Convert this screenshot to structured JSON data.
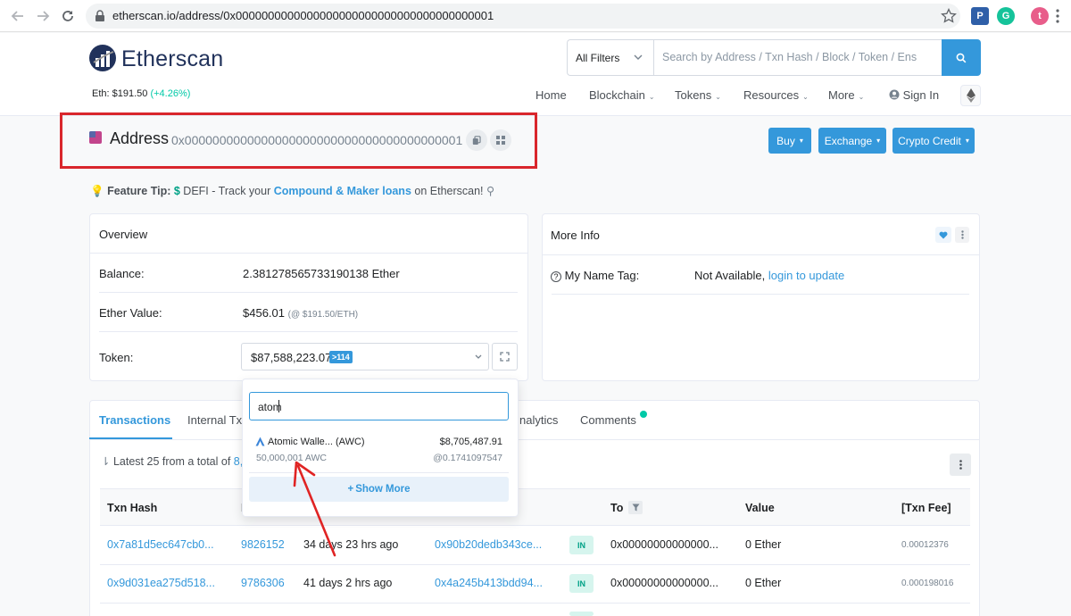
{
  "browser": {
    "url": "etherscan.io/address/0x0000000000000000000000000000000000000001",
    "profile_initial": "t"
  },
  "header": {
    "logo_text": "Etherscan",
    "eth_price_label": "Eth: $191.50",
    "eth_price_change": "(+4.26%)",
    "filter_label": "All Filters",
    "search_placeholder": "Search by Address / Txn Hash / Block / Token / Ens",
    "menu": {
      "home": "Home",
      "blockchain": "Blockchain",
      "tokens": "Tokens",
      "resources": "Resources",
      "more": "More",
      "signin": "Sign In"
    }
  },
  "address": {
    "title": "Address",
    "hash": "0x0000000000000000000000000000000000000001"
  },
  "actions": {
    "buy": "Buy",
    "exchange": "Exchange",
    "crypto_credit": "Crypto Credit"
  },
  "tip": {
    "label": "Feature Tip:",
    "dollar": "$",
    "defi": "DEFI",
    "text1": " - Track your ",
    "link": "Compound & Maker loans",
    "text2": " on Etherscan!"
  },
  "overview": {
    "title": "Overview",
    "balance_label": "Balance:",
    "balance_value": "2.381278565733190138 Ether",
    "ether_value_label": "Ether Value:",
    "ether_value": "$456.01",
    "ether_value_rate": "(@ $191.50/ETH)",
    "token_label": "Token:",
    "token_value": "$87,588,223.07",
    "token_badge": ">114"
  },
  "more_info": {
    "title": "More Info",
    "name_tag_label": "My Name Tag:",
    "name_tag_value": "Not Available,",
    "name_tag_link": "login to update"
  },
  "tabs": {
    "transactions": "Transactions",
    "internal": "Internal Txn",
    "analytics": "nalytics",
    "comments": "Comments"
  },
  "latest": {
    "prefix": "Latest 25 from a total of",
    "count": "8,27"
  },
  "table": {
    "headers": {
      "txn_hash": "Txn Hash",
      "block": "B",
      "to": "To",
      "value": "Value",
      "fee": "[Txn Fee]"
    },
    "rows": [
      {
        "hash": "0x7a81d5ec647cb0...",
        "block": "9826152",
        "age": "34 days 23 hrs ago",
        "from": "0x90b20dedb343ce...",
        "dir": "IN",
        "to": "0x00000000000000...",
        "value": "0 Ether",
        "fee": "0.00012376"
      },
      {
        "hash": "0x9d031ea275d518...",
        "block": "9786306",
        "age": "41 days 2 hrs ago",
        "from": "0x4a245b413bdd94...",
        "dir": "IN",
        "to": "0x00000000000000...",
        "value": "0 Ether",
        "fee": "0.000198016"
      }
    ]
  },
  "dropdown": {
    "search_value": "atom",
    "token_name": "Atomic Walle... (AWC)",
    "token_amount": "50,000,001 AWC",
    "token_value": "$8,705,487.91",
    "token_rate": "@0.1741097547",
    "show_more": "Show More"
  },
  "colors": {
    "accent": "#3498db",
    "highlight_box": "#d9262c",
    "annotation_arrow": "#e02424",
    "success": "#00c9a7"
  }
}
